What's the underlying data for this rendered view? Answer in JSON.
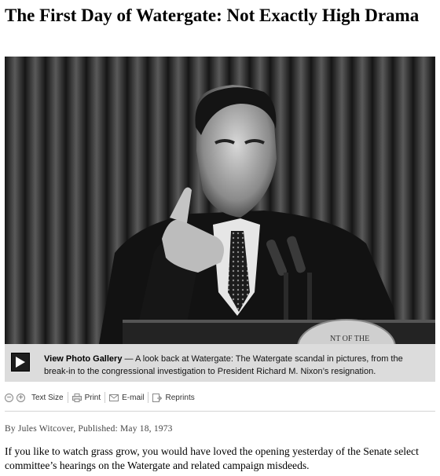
{
  "article": {
    "headline": "The First Day of Watergate: Not Exactly High Drama",
    "byline": "By Jules Witcover, Published: May 18, 1973",
    "body": "If you like to watch grass grow, you would have loved the opening yesterday of the Senate select committee’s hearings on the Watergate and related campaign misdeeds."
  },
  "photo": {
    "seal_text": "NT OF THE"
  },
  "gallery": {
    "link_label": "View Photo Gallery",
    "description": " — A look back at Watergate: The Watergate scandal in pictures, from the break-in to the congressional investigation to President Richard M. Nixon’s resignation."
  },
  "toolbar": {
    "decrease_glyph": "−",
    "increase_glyph": "+",
    "text_size_label": "Text Size",
    "print_label": "Print",
    "email_label": "E-mail",
    "reprints_label": "Reprints"
  },
  "icons": {
    "play": "play-icon",
    "print": "printer-icon",
    "email": "envelope-icon",
    "reprints": "reprints-icon"
  },
  "colors": {
    "caption_background": "#dcdcdc",
    "rule": "#d4d4d4"
  }
}
